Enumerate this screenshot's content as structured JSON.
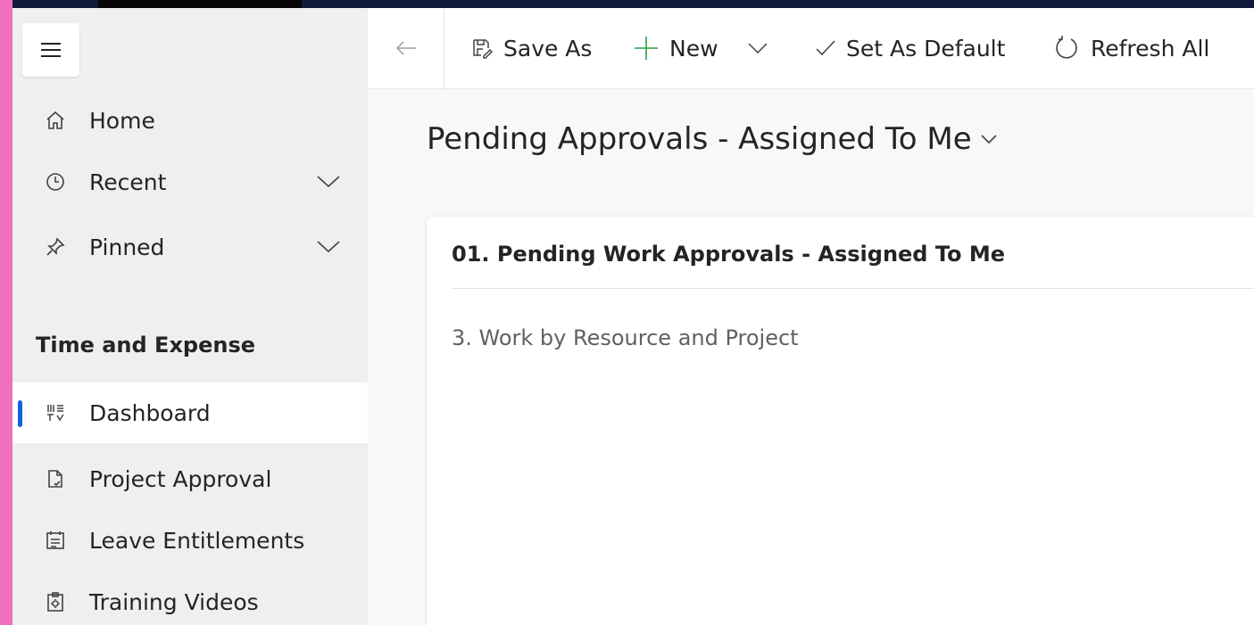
{
  "window": {
    "accent": "#1160e0",
    "new_icon_color": "#2e9c46"
  },
  "toolbar": {
    "save_as_label": "Save As",
    "new_label": "New",
    "set_default_label": "Set As Default",
    "refresh_all_label": "Refresh All"
  },
  "sidebar": {
    "top_items": [
      {
        "label": "Home",
        "icon": "home-icon"
      },
      {
        "label": "Recent",
        "icon": "clock-icon"
      },
      {
        "label": "Pinned",
        "icon": "pin-icon"
      }
    ],
    "section_title": "Time and Expense",
    "section_items": [
      {
        "label": "Dashboard",
        "icon": "dashboard-icon",
        "active": true
      },
      {
        "label": "Project Approval",
        "icon": "document-icon"
      },
      {
        "label": "Leave Entitlements",
        "icon": "calendar-list-icon"
      },
      {
        "label": "Training Videos",
        "icon": "clipboard-gear-icon"
      }
    ]
  },
  "main": {
    "page_title": "Pending Approvals - Assigned To Me",
    "card": {
      "title": "01. Pending Work Approvals - Assigned To Me",
      "subtitle": "3. Work by Resource and Project"
    }
  }
}
